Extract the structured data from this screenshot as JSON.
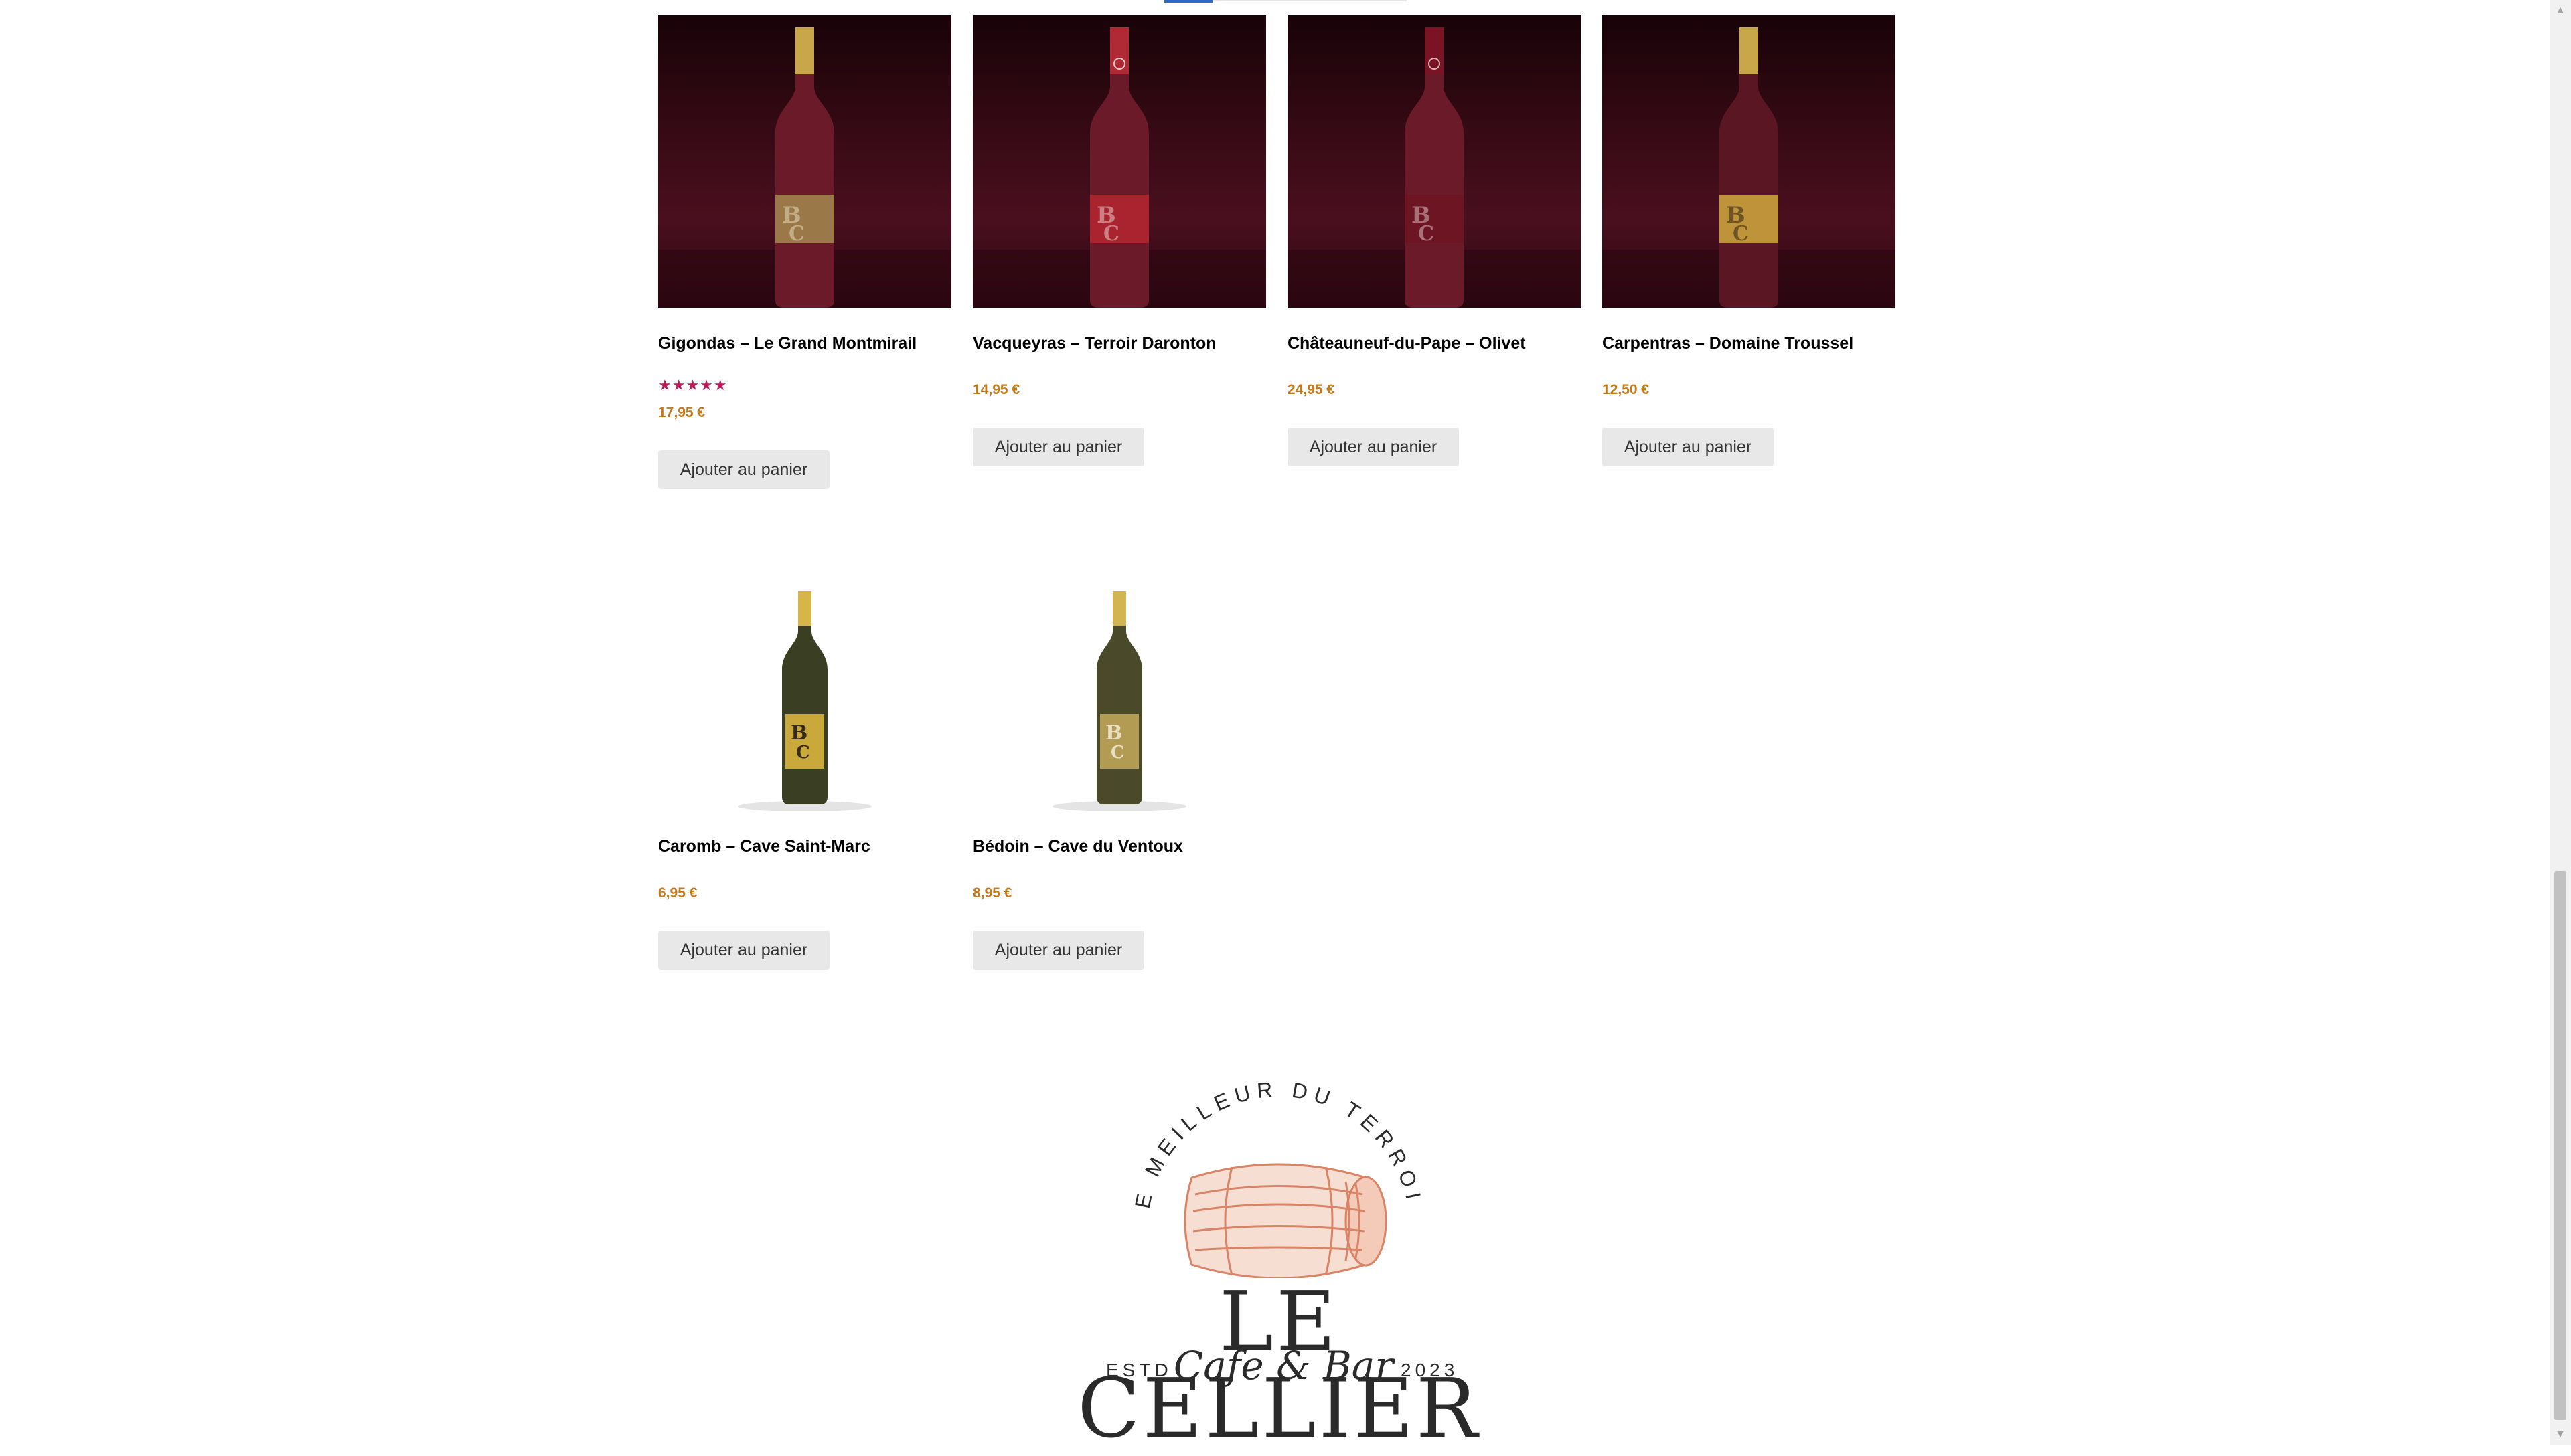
{
  "products": [
    {
      "name": "Gigondas – Le Grand Montmirail",
      "rating": "★★★★★",
      "price": "17,95 €",
      "button": "Ajouter au panier",
      "wine": "red"
    },
    {
      "name": "Vacqueyras – Terroir Daronton",
      "price": "14,95 €",
      "button": "Ajouter au panier",
      "wine": "red"
    },
    {
      "name": "Châteauneuf-du-Pape – Olivet",
      "price": "24,95 €",
      "button": "Ajouter au panier",
      "wine": "red"
    },
    {
      "name": "Carpentras – Domaine Troussel",
      "price": "12,50 €",
      "button": "Ajouter au panier",
      "wine": "red"
    },
    {
      "name": "Caromb – Cave Saint-Marc",
      "price": "6,95 €",
      "button": "Ajouter au panier",
      "wine": "white"
    },
    {
      "name": "Bédoin – Cave du Ventoux",
      "price": "8,95 €",
      "button": "Ajouter au panier",
      "wine": "white"
    }
  ],
  "logo": {
    "arc_text": "LE MEILLEUR DU TERROIR",
    "name": "LE CELLIER",
    "estd": "ESTD",
    "script": "Cafe & Bar",
    "year": "2023"
  },
  "colors": {
    "price": "#c47a1a",
    "rating_star": "#c2185b",
    "button_bg": "#e8e8e8",
    "barrel": "#d98466"
  },
  "scrollbar": {
    "up_icon": "▲",
    "down_icon": "▼"
  }
}
